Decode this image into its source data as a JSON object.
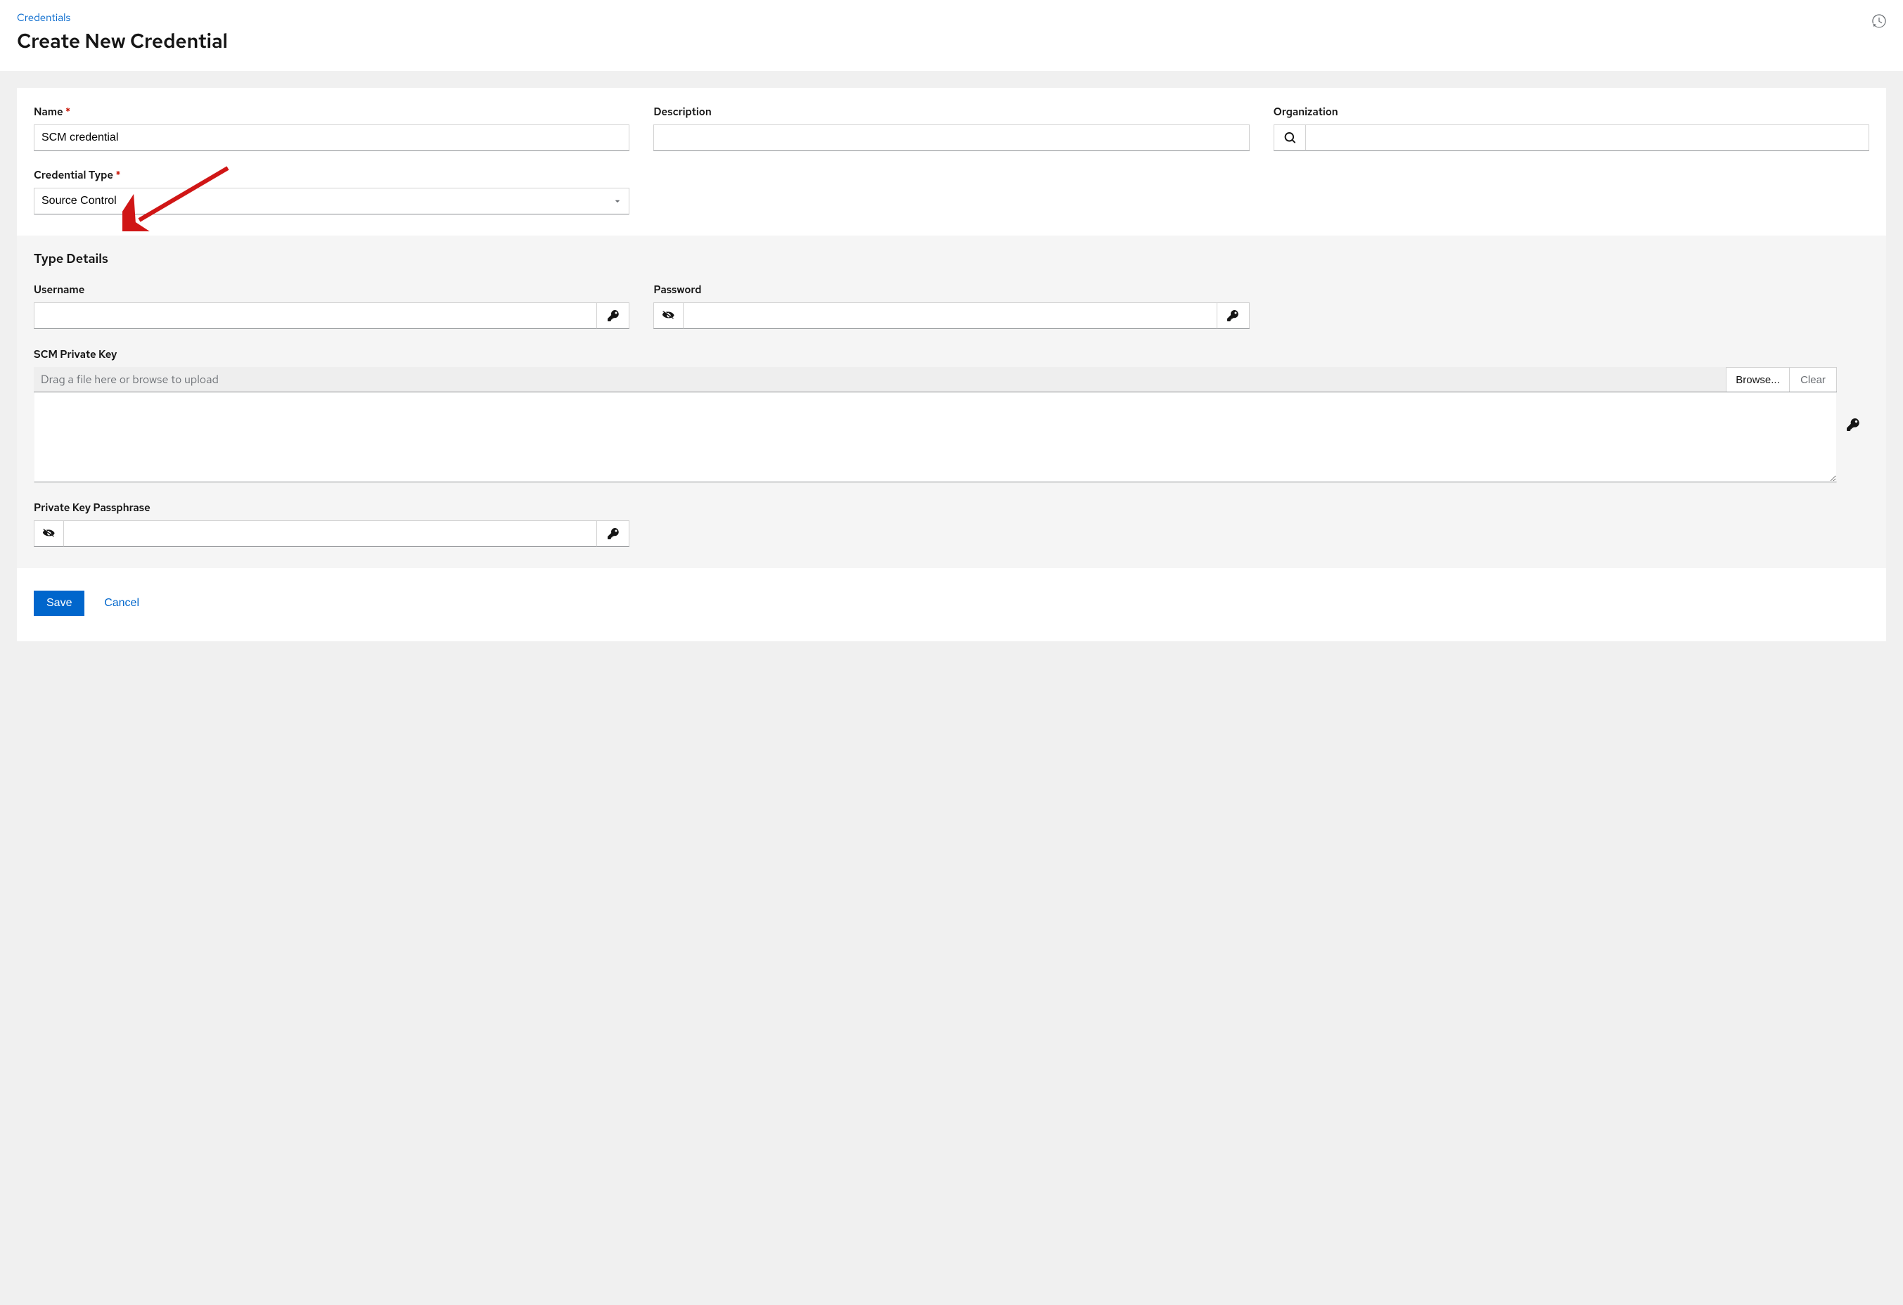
{
  "breadcrumb": {
    "parent": "Credentials"
  },
  "pageTitle": "Create New Credential",
  "fields": {
    "name": {
      "label": "Name",
      "value": "SCM credential"
    },
    "description": {
      "label": "Description",
      "value": ""
    },
    "organization": {
      "label": "Organization",
      "value": ""
    },
    "credentialType": {
      "label": "Credential Type",
      "value": "Source Control"
    }
  },
  "typeDetails": {
    "heading": "Type Details",
    "username": {
      "label": "Username",
      "value": ""
    },
    "password": {
      "label": "Password",
      "value": ""
    },
    "scmPrivateKey": {
      "label": "SCM Private Key",
      "placeholder": "Drag a file here or browse to upload",
      "browseLabel": "Browse...",
      "clearLabel": "Clear",
      "value": ""
    },
    "passphrase": {
      "label": "Private Key Passphrase",
      "value": ""
    }
  },
  "actions": {
    "save": "Save",
    "cancel": "Cancel"
  }
}
